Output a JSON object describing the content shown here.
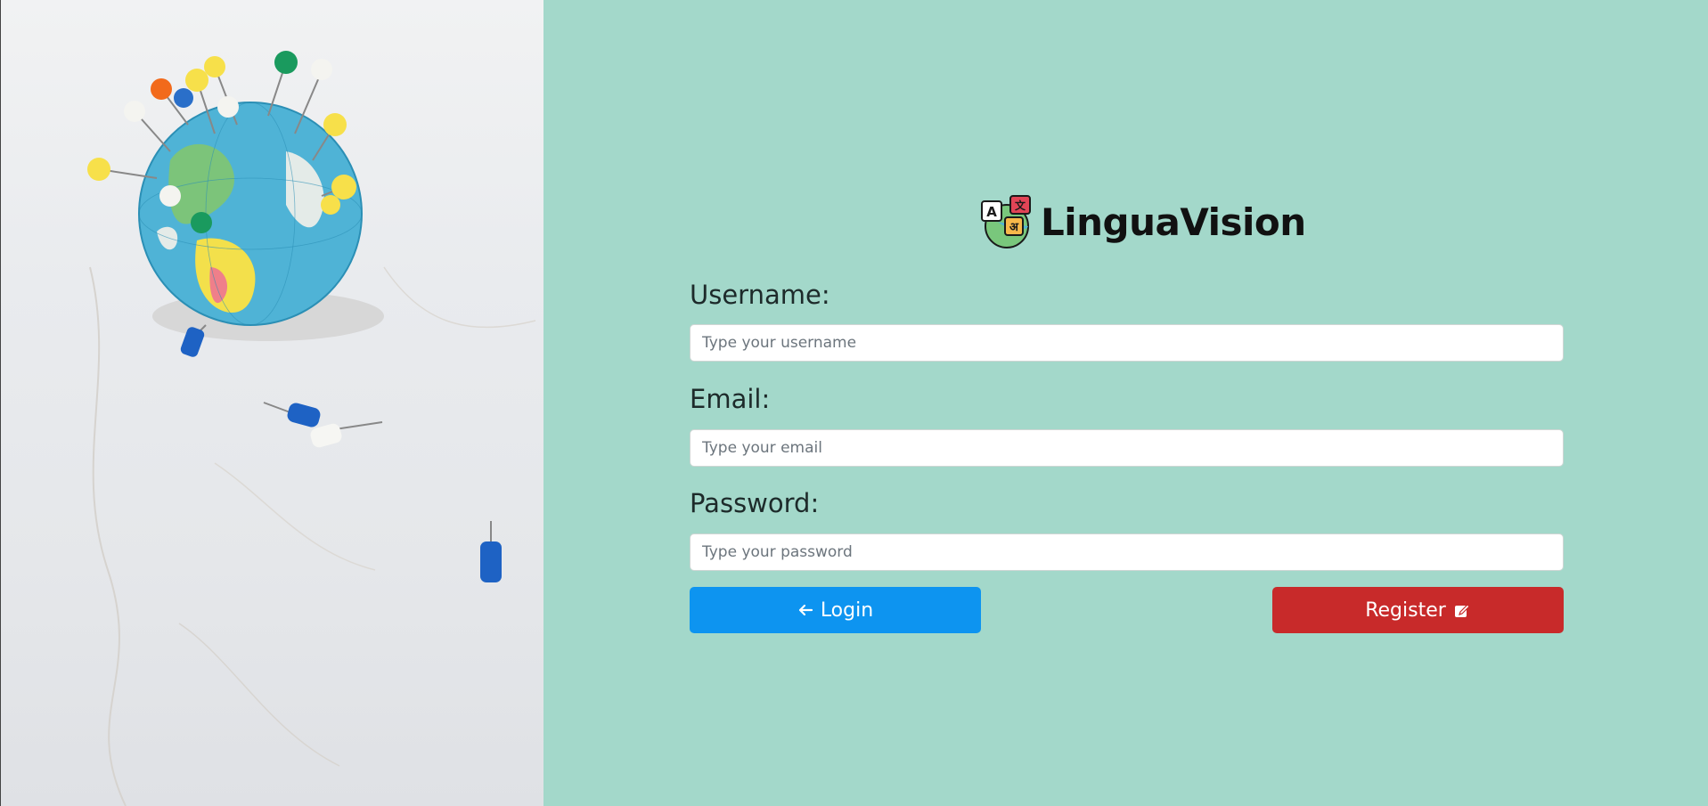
{
  "brand": {
    "title": "LinguaVision",
    "logo_icon": "language-translate-icon",
    "logo_letters": [
      "A",
      "文",
      "अ"
    ]
  },
  "form": {
    "username": {
      "label": "Username:",
      "placeholder": "Type your username",
      "value": ""
    },
    "email": {
      "label": "Email:",
      "placeholder": "Type your email",
      "value": ""
    },
    "password": {
      "label": "Password:",
      "placeholder": "Type your password",
      "value": ""
    }
  },
  "actions": {
    "login": {
      "label": "Login",
      "icon": "arrow-left-icon"
    },
    "register": {
      "label": "Register",
      "icon": "pencil-square-icon"
    }
  },
  "colors": {
    "panel_bg": "#a3d8ca",
    "login_bg": "#0d94f0",
    "register_bg": "#c82a2a"
  }
}
